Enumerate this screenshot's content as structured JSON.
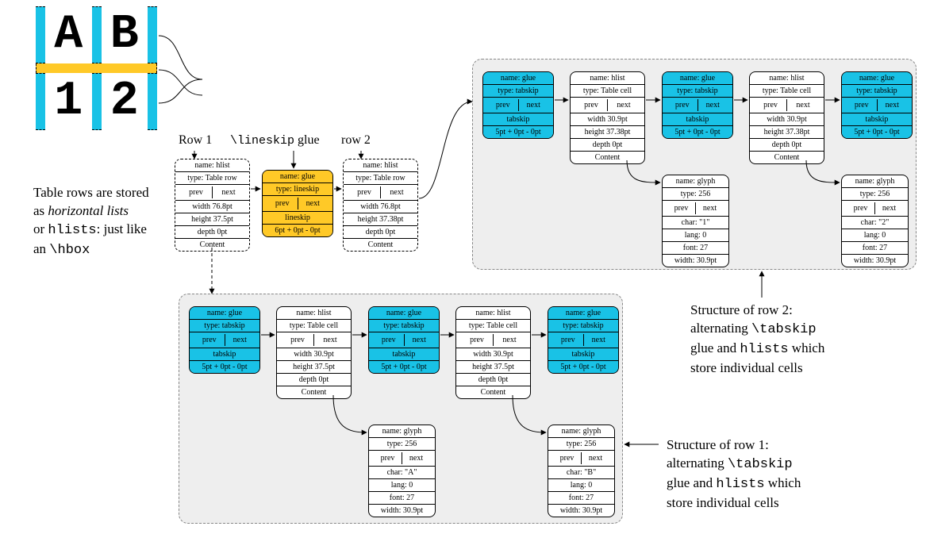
{
  "thumb": {
    "a": "A",
    "b": "B",
    "one": "1",
    "two": "2"
  },
  "labels": {
    "row1": "Row 1",
    "lineskip_pre": "\\lineskip",
    "lineskip_post": " glue",
    "row2": "row 2"
  },
  "para": {
    "l1a": "Table rows are stored",
    "l2a": "as ",
    "l2b": "horizontal lists",
    "l3a": "or ",
    "l3b": "hlists",
    "l3c": ": just like",
    "l4a": "an ",
    "l4b": "\\hbox"
  },
  "common": {
    "prev": "prev",
    "next": "next",
    "content": "Content"
  },
  "rowHlist": {
    "name": "name: hlist",
    "type": "type: Table row",
    "width": "width 76.8pt",
    "h1": "height 37.5pt",
    "h2": "height 37.38pt",
    "depth": "depth 0pt"
  },
  "lineskipGlue": {
    "name": "name: glue",
    "type": "type: lineskip",
    "sub": "lineskip",
    "val": "6pt + 0pt - 0pt"
  },
  "tabskip": {
    "name": "name: glue",
    "type": "type: tabskip",
    "sub": "tabskip",
    "val": "5pt + 0pt - 0pt"
  },
  "cellHlist": {
    "name": "name: hlist",
    "type": "type: Table cell",
    "width": "width 30.9pt",
    "h1": "height 37.5pt",
    "h2": "height 37.38pt",
    "depth": "depth 0pt"
  },
  "glyph": {
    "name": "name: glyph",
    "type": "type: 256",
    "charA": "char: \"A\"",
    "charB": "char: \"B\"",
    "char1": "char: \"1\"",
    "char2": "char: \"2\"",
    "lang": "lang: 0",
    "font": "font: 27",
    "width": "width: 30.9pt"
  },
  "captions": {
    "r1a": "Structure of row 1:",
    "r1b_pre": "alternating ",
    "r1b_code": "\\tabskip",
    "r1c_pre": "glue and ",
    "r1c_code": "hlists",
    "r1c_post": " which",
    "r1d": "store individual cells",
    "r2a": "Structure of row 2:"
  }
}
